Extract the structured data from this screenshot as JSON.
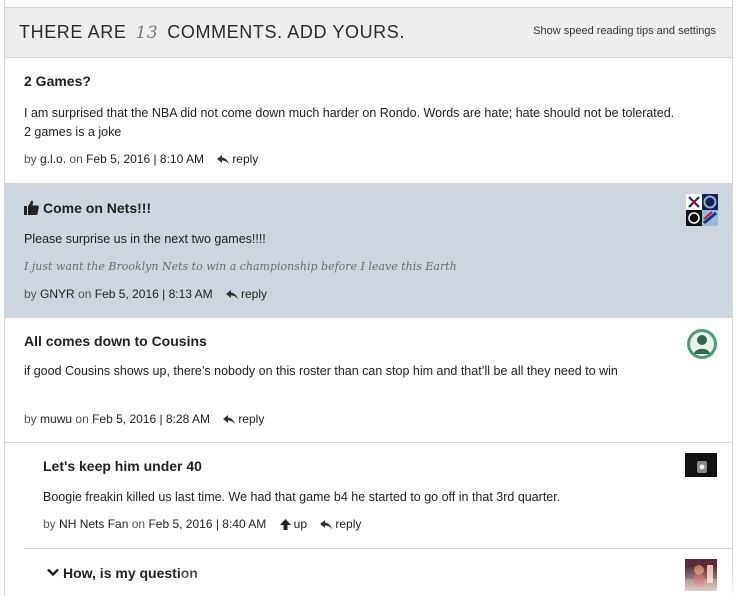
{
  "header": {
    "title_prefix": "THERE ARE",
    "count": "13",
    "title_suffix": "COMMENTS. ADD YOURS.",
    "tips_link": "Show speed reading tips and settings"
  },
  "labels": {
    "by": "by",
    "on": "on",
    "reply": "reply",
    "up": "up"
  },
  "comments": [
    {
      "title": "2 Games?",
      "body": "I am surprised that the NBA did not come down much harder on Rondo. Words are hate; hate should not be tolerated. 2 games is a joke",
      "user": "g.l.o.",
      "date": "Feb 5, 2016 | 8:10 AM"
    },
    {
      "title": "Come on Nets!!!",
      "body": "Please surprise us in the next two games!!!!",
      "signature": "I just want the Brooklyn Nets to win a championship before I leave this Earth",
      "user": "GNYR",
      "date": "Feb 5, 2016 | 8:13 AM"
    },
    {
      "title": "All comes down to Cousins",
      "body": "if good Cousins shows up, there’s nobody on this roster than can stop him and that’ll be all they need to win",
      "user": "muwu",
      "date": "Feb 5, 2016 | 8:28 AM"
    },
    {
      "title": "Let's keep him under 40",
      "body": "Boogie freakin killed us last time. We had that game b4 he started to go off in that 3rd quarter.",
      "user": "NH Nets Fan",
      "date": "Feb 5, 2016 | 8:40 AM"
    },
    {
      "title": "How, is my question"
    }
  ],
  "colors": {
    "highlight_bg": "#cdd6df",
    "header_bg": "#eeeeee",
    "border": "#d6d6d6"
  }
}
